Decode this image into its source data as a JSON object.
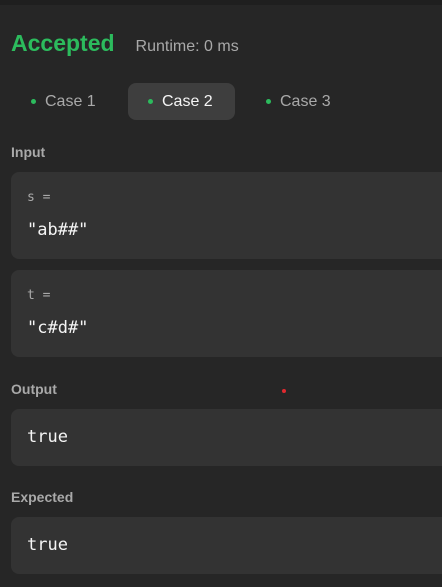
{
  "result": {
    "status": "Accepted",
    "runtime": "Runtime: 0 ms"
  },
  "tabs": [
    {
      "label": "Case 1",
      "active": false
    },
    {
      "label": "Case 2",
      "active": true
    },
    {
      "label": "Case 3",
      "active": false
    }
  ],
  "input": {
    "label": "Input",
    "params": [
      {
        "name": "s =",
        "value": "\"ab##\""
      },
      {
        "name": "t =",
        "value": "\"c#d#\""
      }
    ]
  },
  "output": {
    "label": "Output",
    "value": "true"
  },
  "expected": {
    "label": "Expected",
    "value": "true"
  },
  "colors": {
    "accepted": "#2cbb5d",
    "background": "#262626",
    "panel": "#333333",
    "active_tab": "#3e3e3e",
    "muted_text": "#a9a9a9"
  }
}
